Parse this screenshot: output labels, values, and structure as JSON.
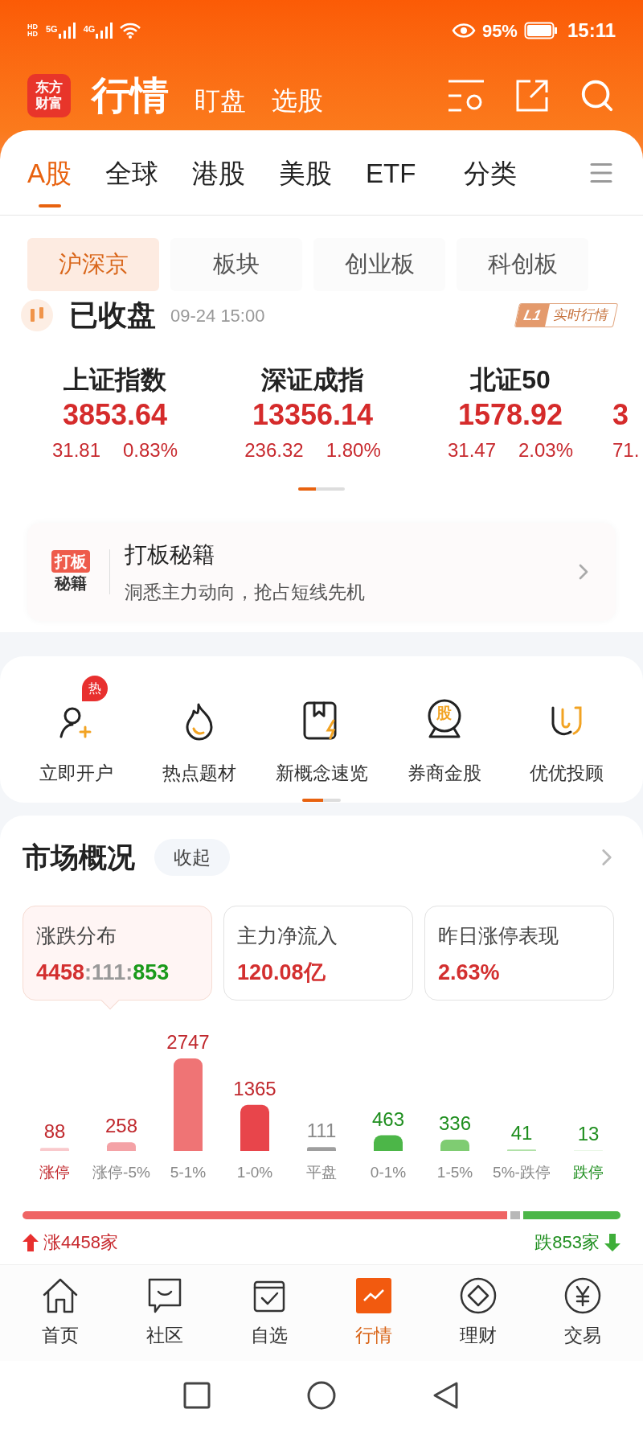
{
  "status_bar": {
    "sim_badges": [
      "HD",
      "HD"
    ],
    "networks": [
      "5G",
      "4G"
    ],
    "battery": "95%",
    "time": "15:11"
  },
  "header": {
    "logo_lines": [
      "东方",
      "财富"
    ],
    "title": "行情",
    "links": [
      "盯盘",
      "选股"
    ]
  },
  "tabs": [
    {
      "label": "A股",
      "selected": true
    },
    {
      "label": "全球",
      "selected": false
    },
    {
      "label": "港股",
      "selected": false
    },
    {
      "label": "美股",
      "selected": false
    },
    {
      "label": "ETF",
      "selected": false
    },
    {
      "label": "分类",
      "selected": false
    }
  ],
  "sub_tabs": [
    {
      "label": "沪深京",
      "selected": true
    },
    {
      "label": "板块",
      "selected": false
    },
    {
      "label": "创业板",
      "selected": false
    },
    {
      "label": "科创板",
      "selected": false
    }
  ],
  "market_status": {
    "label": "已收盘",
    "time": "09-24 15:00",
    "badge_level": "L1",
    "badge_text": "实时行情"
  },
  "indices": [
    {
      "name": "上证指数",
      "value": "3853.64",
      "change": "31.81",
      "percent": "0.83%"
    },
    {
      "name": "深证成指",
      "value": "13356.14",
      "change": "236.32",
      "percent": "1.80%"
    },
    {
      "name": "北证50",
      "value": "1578.92",
      "change": "31.47",
      "percent": "2.03%"
    },
    {
      "value": "3",
      "change": "71."
    }
  ],
  "banner": {
    "logo_lines": [
      "打板",
      "秘籍"
    ],
    "title": "打板秘籍",
    "subtitle": "洞悉主力动向，抢占短线先机"
  },
  "shortcuts": [
    {
      "kind": "account",
      "label": "立即开户",
      "badge": "热"
    },
    {
      "kind": "flame",
      "label": "热点题材"
    },
    {
      "kind": "book",
      "label": "新概念速览"
    },
    {
      "kind": "medal",
      "label": "券商金股",
      "icon_text": "股"
    },
    {
      "kind": "magnet",
      "label": "优优投顾"
    }
  ],
  "market_overview": {
    "title": "市场概况",
    "collapse_button": "收起",
    "stats": [
      {
        "label": "涨跌分布",
        "selected": true,
        "parts": [
          {
            "text": "4458",
            "color": "#d32f2f"
          },
          {
            "text": ":",
            "color": "#999999"
          },
          {
            "text": "111",
            "color": "#999999"
          },
          {
            "text": ":",
            "color": "#999999"
          },
          {
            "text": "853",
            "color": "#1a9a1a"
          }
        ]
      },
      {
        "label": "主力净流入",
        "selected": false,
        "parts": [
          {
            "text": "120.08亿",
            "color": "#d32f2f"
          }
        ]
      },
      {
        "label": "昨日涨停表现",
        "selected": false,
        "parts": [
          {
            "text": "2.63%",
            "color": "#d32f2f"
          }
        ]
      }
    ],
    "chart_data": {
      "type": "bar",
      "categories": [
        "涨停",
        "涨停-5%",
        "5-1%",
        "1-0%",
        "平盘",
        "0-1%",
        "1-5%",
        "5%-跌停",
        "跌停"
      ],
      "values": [
        88,
        258,
        2747,
        1365,
        111,
        463,
        336,
        41,
        13
      ],
      "data_labels": true,
      "colors": [
        "#f9c9cc",
        "#f4a2a6",
        "#ef7475",
        "#e8454b",
        "#9e9e9e",
        "#4cb648",
        "#7fcc72",
        "#b1e1a8",
        "#d5efd0"
      ]
    },
    "breadth_bar": {
      "level": 0.81
    },
    "up_count": "涨4458家",
    "down_count": "跌853家"
  },
  "bottom_nav": [
    {
      "kind": "home",
      "label": "首页",
      "selected": false
    },
    {
      "kind": "chat",
      "label": "社区",
      "selected": false
    },
    {
      "kind": "check",
      "label": "自选",
      "selected": false
    },
    {
      "kind": "trend",
      "label": "行情",
      "selected": true
    },
    {
      "kind": "diamond",
      "label": "理财",
      "selected": false
    },
    {
      "kind": "yen",
      "label": "交易",
      "selected": false
    }
  ]
}
